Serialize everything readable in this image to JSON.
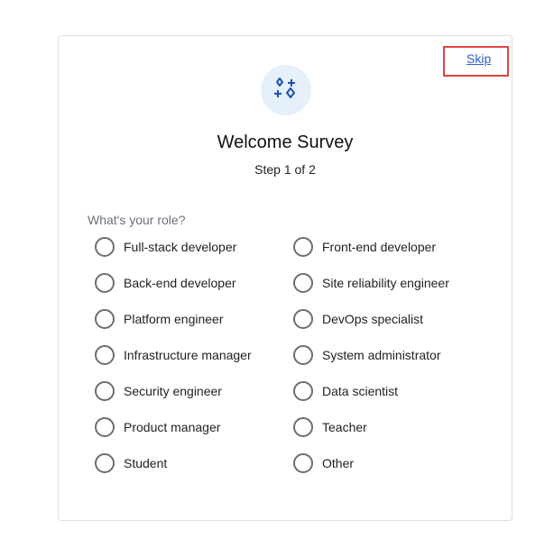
{
  "header": {
    "skip_label": "Skip",
    "icon": "sparkles-icon",
    "title": "Welcome Survey",
    "step": "Step 1 of 2"
  },
  "form": {
    "question": "What's your role?",
    "options": [
      "Full-stack developer",
      "Front-end developer",
      "Back-end developer",
      "Site reliability engineer",
      "Platform engineer",
      "DevOps specialist",
      "Infrastructure manager",
      "System administrator",
      "Security engineer",
      "Data scientist",
      "Product manager",
      "Teacher",
      "Student",
      "Other"
    ]
  },
  "colors": {
    "accent": "#2e61c9",
    "highlight": "#e0453f",
    "icon_bg": "#e6f0fb"
  }
}
